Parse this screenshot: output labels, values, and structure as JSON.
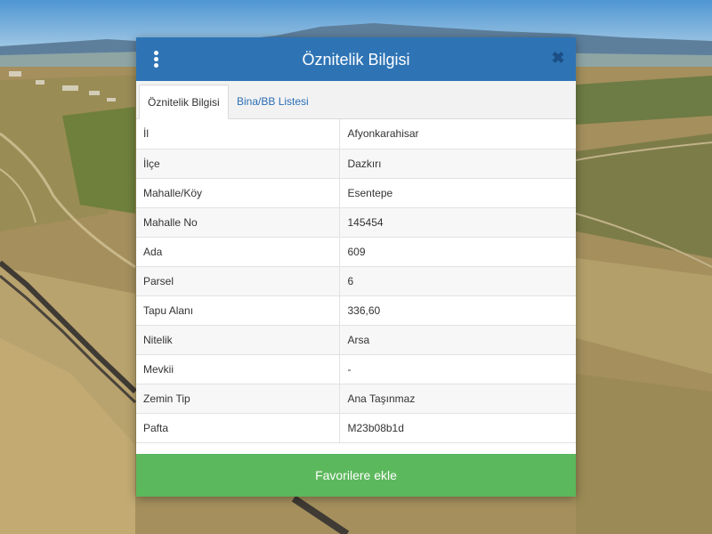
{
  "dialog": {
    "title": "Öznitelik Bilgisi",
    "close_icon": "✖",
    "menu_icon": "vertical-ellipsis",
    "header_color": "#2e74b5",
    "tabs": [
      {
        "label": "Öznitelik Bilgisi",
        "active": true
      },
      {
        "label": "Bina/BB Listesi",
        "active": false
      }
    ],
    "rows": [
      {
        "key": "İl",
        "value": "Afyonkarahisar"
      },
      {
        "key": "İlçe",
        "value": "Dazkırı"
      },
      {
        "key": "Mahalle/Köy",
        "value": "Esentepe"
      },
      {
        "key": "Mahalle No",
        "value": "145454"
      },
      {
        "key": "Ada",
        "value": "609"
      },
      {
        "key": "Parsel",
        "value": "6"
      },
      {
        "key": "Tapu Alanı",
        "value": "336,60"
      },
      {
        "key": "Nitelik",
        "value": "Arsa"
      },
      {
        "key": "Mevkii",
        "value": "-"
      },
      {
        "key": "Zemin Tip",
        "value": "Ana Taşınmaz"
      },
      {
        "key": "Pafta",
        "value": "M23b08b1d"
      }
    ],
    "favorite_button": "Favorilere ekle",
    "favorite_color": "#5cb85c"
  }
}
